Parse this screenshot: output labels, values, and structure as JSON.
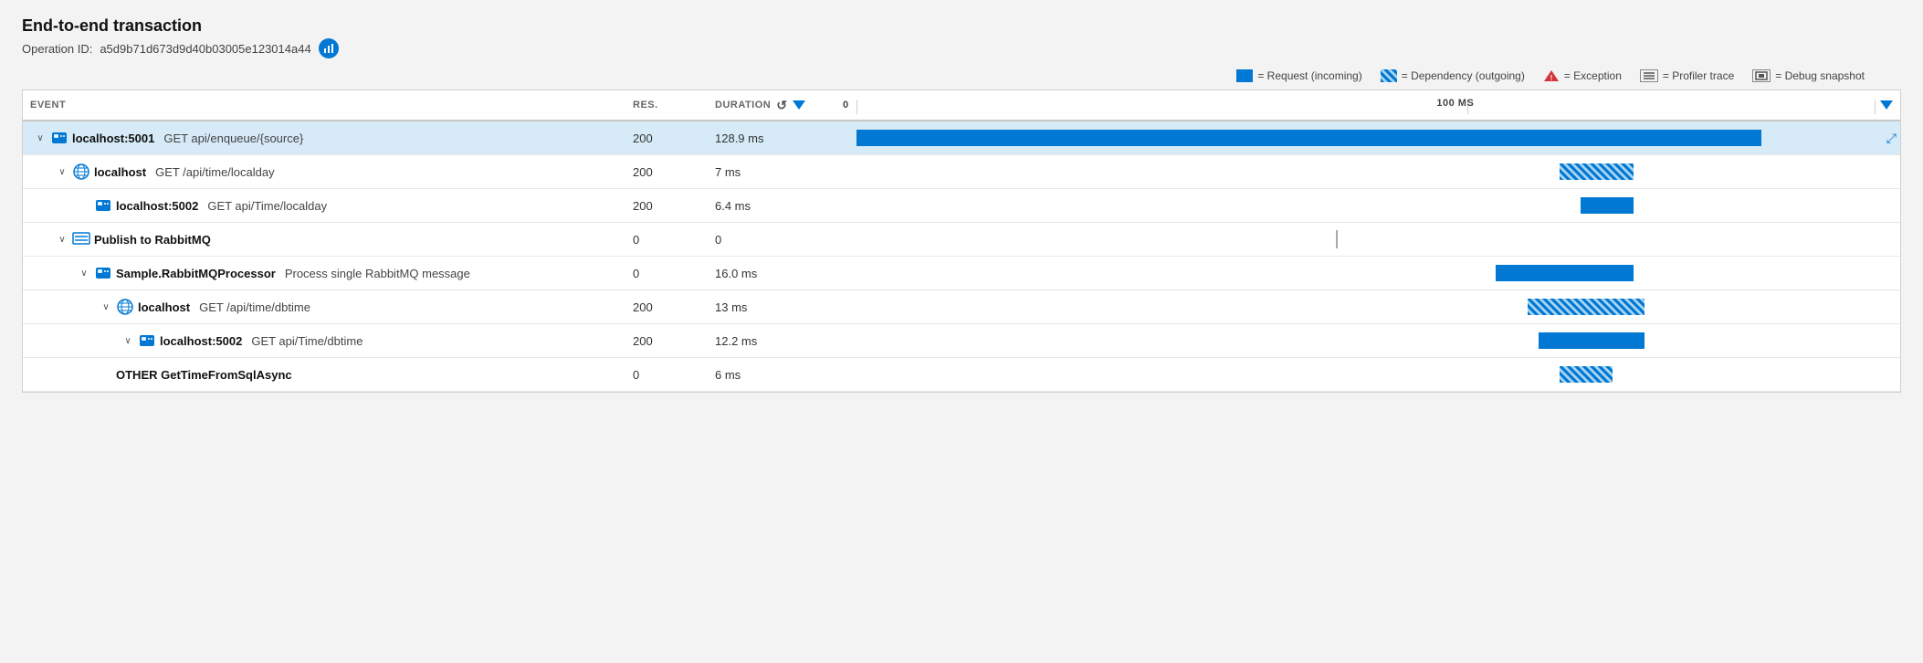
{
  "header": {
    "title": "End-to-end transaction",
    "operation_label": "Operation ID:",
    "operation_id": "a5d9b71d673d9d40b03005e123014a44"
  },
  "legend": {
    "request_label": "= Request (incoming)",
    "dependency_label": "= Dependency (outgoing)",
    "exception_label": "= Exception",
    "profiler_label": "= Profiler trace",
    "debug_label": "= Debug snapshot"
  },
  "columns": {
    "event": "EVENT",
    "res": "RES.",
    "duration": "DURATION",
    "timeline_zero": "0",
    "timeline_100ms": "100 MS"
  },
  "rows": [
    {
      "indent": 0,
      "chevron": "∨",
      "icon": "server",
      "name": "localhost:5001",
      "detail": "GET api/enqueue/{source}",
      "res": "200",
      "duration": "128.9 ms",
      "bar_type": "solid",
      "bar_left_pct": 2,
      "bar_width_pct": 85,
      "highlighted": true,
      "expand_btn": true
    },
    {
      "indent": 1,
      "chevron": "∨",
      "icon": "globe",
      "name": "localhost",
      "detail": "GET /api/time/localday",
      "res": "200",
      "duration": "7 ms",
      "bar_type": "hatch",
      "bar_left_pct": 68,
      "bar_width_pct": 7,
      "highlighted": false,
      "expand_btn": false
    },
    {
      "indent": 2,
      "chevron": "",
      "icon": "server",
      "name": "localhost:5002",
      "detail": "GET api/Time/localday",
      "res": "200",
      "duration": "6.4 ms",
      "bar_type": "solid",
      "bar_left_pct": 70,
      "bar_width_pct": 5,
      "highlighted": false,
      "expand_btn": false
    },
    {
      "indent": 1,
      "chevron": "∨",
      "icon": "queue",
      "name": "Publish to RabbitMQ",
      "detail": "",
      "res": "0",
      "duration": "0",
      "bar_type": "dashed",
      "bar_left_pct": 47,
      "bar_width_pct": 0,
      "highlighted": false,
      "expand_btn": false
    },
    {
      "indent": 2,
      "chevron": "∨",
      "icon": "server",
      "name": "Sample.RabbitMQProcessor",
      "detail": "Process single RabbitMQ message",
      "res": "0",
      "duration": "16.0 ms",
      "bar_type": "solid",
      "bar_left_pct": 62,
      "bar_width_pct": 13,
      "highlighted": false,
      "expand_btn": false
    },
    {
      "indent": 3,
      "chevron": "∨",
      "icon": "globe",
      "name": "localhost",
      "detail": "GET /api/time/dbtime",
      "res": "200",
      "duration": "13 ms",
      "bar_type": "hatch",
      "bar_left_pct": 65,
      "bar_width_pct": 11,
      "highlighted": false,
      "expand_btn": false
    },
    {
      "indent": 4,
      "chevron": "∨",
      "icon": "server",
      "name": "localhost:5002",
      "detail": "GET api/Time/dbtime",
      "res": "200",
      "duration": "12.2 ms",
      "bar_type": "solid",
      "bar_left_pct": 66,
      "bar_width_pct": 10,
      "highlighted": false,
      "expand_btn": false
    },
    {
      "indent": 3,
      "chevron": "",
      "icon": "none",
      "name": "OTHER GetTimeFromSqlAsync",
      "detail": "",
      "res": "0",
      "duration": "6 ms",
      "bar_type": "hatch",
      "bar_left_pct": 68,
      "bar_width_pct": 5,
      "highlighted": false,
      "expand_btn": false
    }
  ]
}
